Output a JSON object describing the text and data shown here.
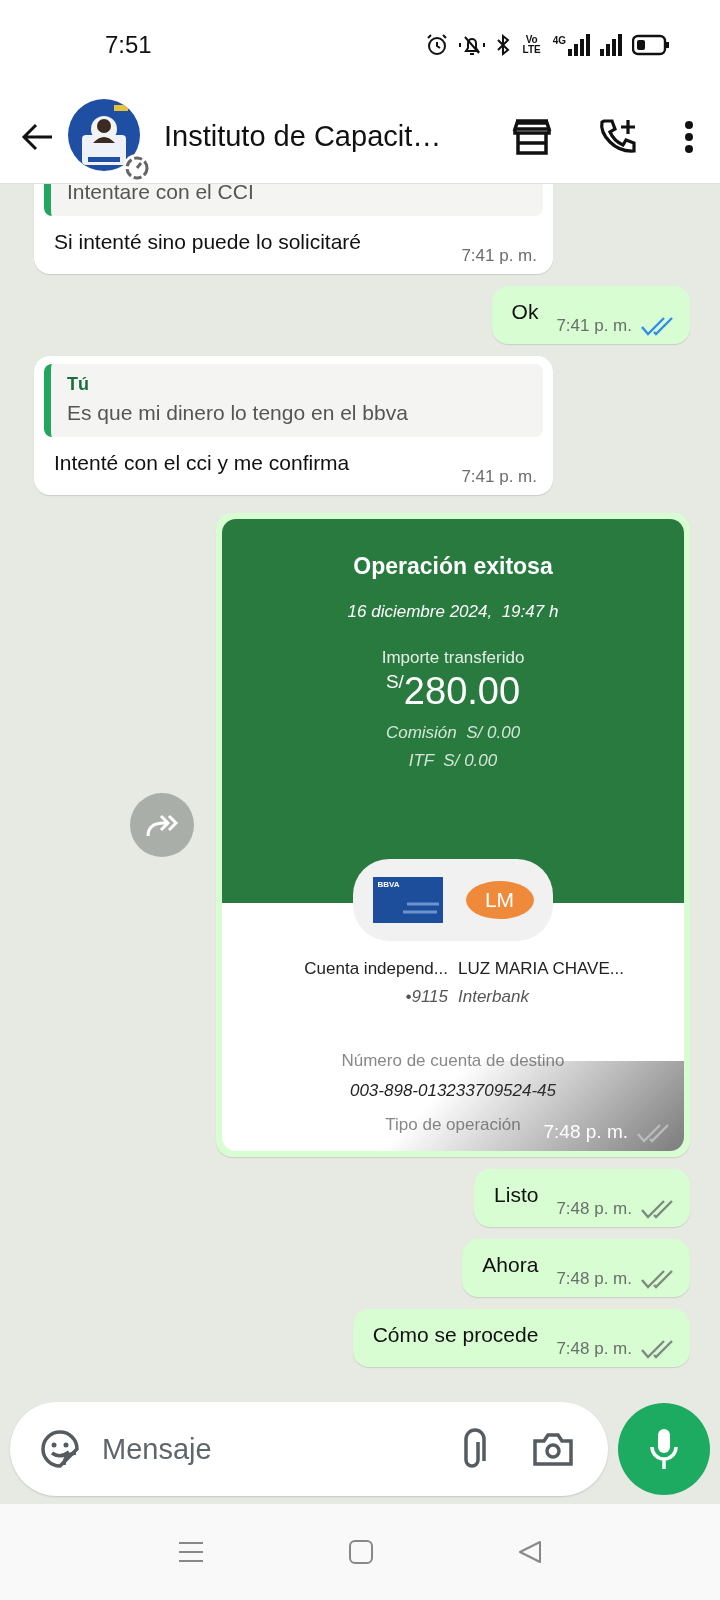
{
  "status_bar": {
    "time": "7:51",
    "volte": "Vo LTE",
    "network": "4G"
  },
  "header": {
    "title": "Instituto de Capacit…"
  },
  "messages": [
    {
      "kind": "text",
      "outgoing": false,
      "quote": {
        "text": "Intentare con el CCI"
      },
      "text": "Si intenté sino puede lo solicitaré",
      "time": "7:41 p. m."
    },
    {
      "kind": "text",
      "outgoing": true,
      "text": "Ok",
      "time": "7:41 p. m.",
      "read": true
    },
    {
      "kind": "text",
      "outgoing": false,
      "quote": {
        "author": "Tú",
        "text": "Es que mi dinero lo tengo en el bbva"
      },
      "text": "Intenté con el cci y me confirma",
      "time": "7:41 p. m."
    },
    {
      "outgoing": true,
      "time": "7:48 p. m.",
      "read": false,
      "receipt": {
        "title": "Operación exitosa",
        "date": "16 diciembre 2024,  19:47 h",
        "amount_label": "Importe transferido",
        "currency": "S/",
        "amount": "280.00",
        "fees": [
          "Comisión  S/ 0.00",
          "ITF  S/ 0.00"
        ],
        "bank_logo": "BBVA",
        "initials": "LM",
        "from": {
          "name": "Cuenta independ...",
          "detail": "•9115"
        },
        "to": {
          "name": "LUZ MARIA CHAVE...",
          "detail": "Interbank"
        },
        "account_label": "Número de cuenta de destino",
        "account_number": "003-898-013233709524-45",
        "type_label": "Tipo de operación"
      }
    },
    {
      "kind": "text",
      "outgoing": true,
      "text": "Listo",
      "time": "7:48 p. m.",
      "read": false
    },
    {
      "kind": "text",
      "outgoing": true,
      "text": "Ahora",
      "time": "7:48 p. m.",
      "read": false
    },
    {
      "kind": "text",
      "outgoing": true,
      "text": "Cómo se procede",
      "time": "7:48 p. m.",
      "read": false
    }
  ],
  "composer": {
    "placeholder": "Mensaje"
  }
}
